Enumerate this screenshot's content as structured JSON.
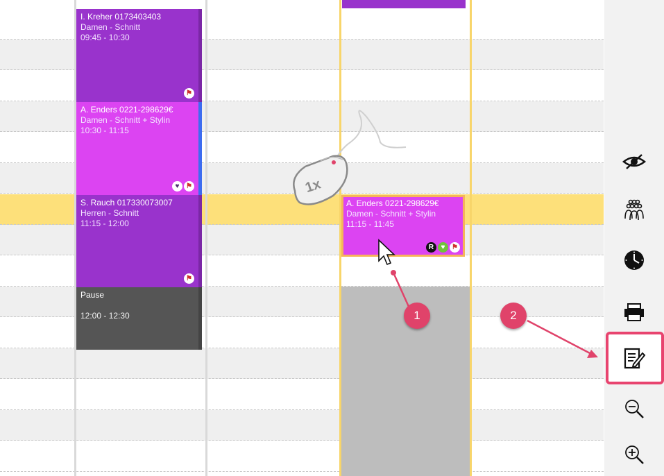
{
  "appointments": [
    {
      "name": "I. Kreher 0173403403",
      "service": "Damen - Schnitt",
      "time": "09:45 - 10:30"
    },
    {
      "name": "A. Enders 0221-298629€",
      "service": "Damen - Schnitt + Stylin",
      "time": "10:30 - 11:15"
    },
    {
      "name": "S. Rauch 017330073007",
      "service": "Herren - Schnitt",
      "time": "11:15 - 12:00"
    },
    {
      "name": "Pause",
      "service": "",
      "time": "12:00 - 12:30"
    },
    {
      "name": "A. Enders 0221-298629€",
      "service": "Damen - Schnitt + Stylin",
      "time": "11:15 - 11:45"
    }
  ],
  "badges": {
    "r": "R"
  },
  "mouse_hint": "1x",
  "callouts": [
    "1",
    "2"
  ],
  "toolbar": [
    {
      "icon": "eye-hidden-icon"
    },
    {
      "icon": "staff-group-icon"
    },
    {
      "icon": "clock-icon"
    },
    {
      "icon": "printer-icon"
    },
    {
      "icon": "notes-edit-icon"
    },
    {
      "icon": "zoom-out-icon"
    },
    {
      "icon": "zoom-in-icon"
    }
  ],
  "colors": {
    "appointment_purple": "#9933cc",
    "appointment_pink": "#dc44f2",
    "pause_grey": "#555555",
    "highlight_row": "#fde07a",
    "callout": "#e0436a"
  }
}
